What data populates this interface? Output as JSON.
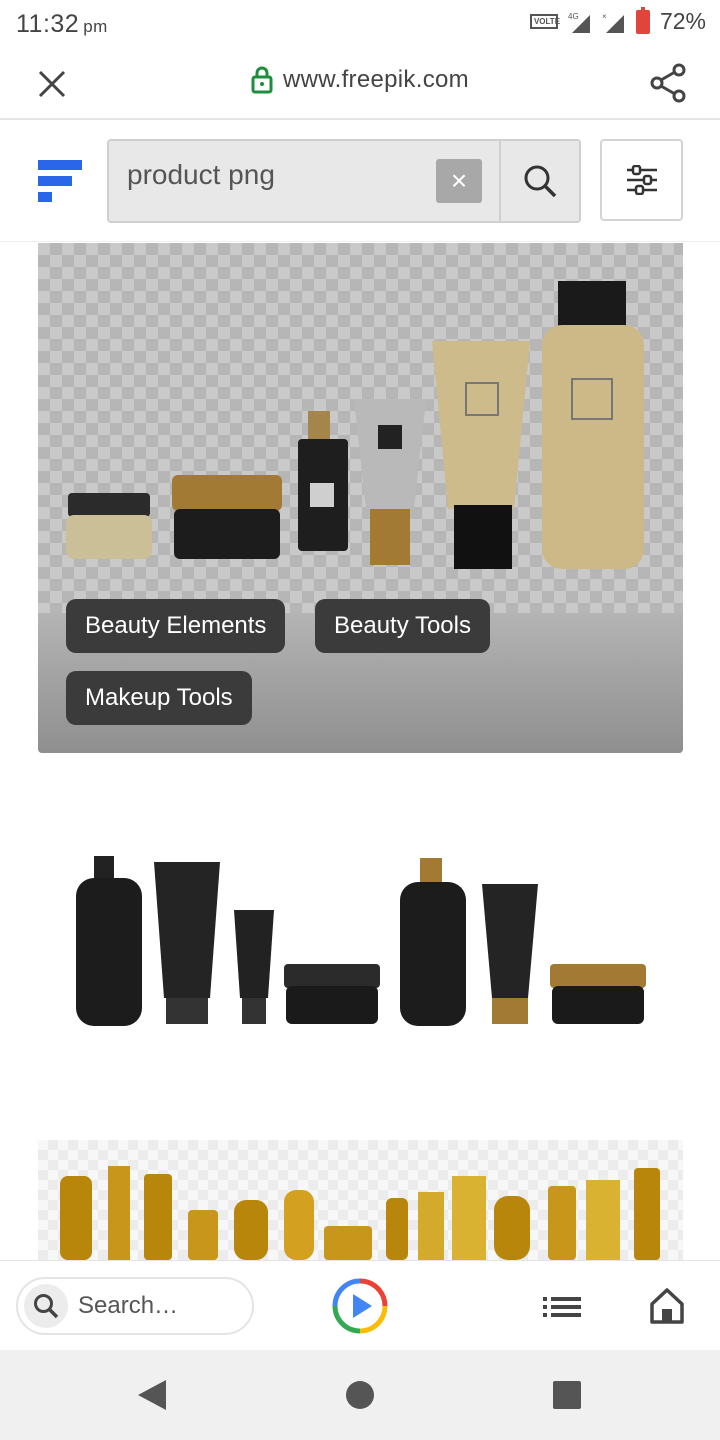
{
  "status_bar": {
    "time": "11:32",
    "time_suffix": "pm",
    "network": "4G",
    "volte": "VOLTE",
    "battery": "72%"
  },
  "browser": {
    "url": "www.freepik.com",
    "icons": [
      "close-icon",
      "lock-icon",
      "share-icon"
    ]
  },
  "header": {
    "logo": "freepik-logo",
    "search": {
      "value": "product png",
      "clear_symbol": "×"
    },
    "icons": [
      "search-icon",
      "filter-sliders-icon"
    ]
  },
  "results": [
    {
      "image": "cosmetic-bottles-transparent-background",
      "tags": [
        "Beauty Elements",
        "Beauty Tools",
        "Makeup Tools"
      ]
    },
    {
      "image": "black-cosmetic-packaging-set"
    },
    {
      "image": "gold-cosmetic-bottles-row"
    }
  ],
  "bottom_bar": {
    "search_placeholder": "Search…",
    "icons": [
      "search-icon",
      "play-logo-icon",
      "list-icon",
      "home-icon"
    ]
  },
  "nav_bar": {
    "icons": [
      "back-icon",
      "home-circle-icon",
      "recent-apps-icon"
    ]
  },
  "colors": {
    "lock_green": "#1e8e3e",
    "logo_blue": "#2a67e8",
    "tag_bg": "#3b3b3b",
    "battery_red": "#e0443a"
  }
}
